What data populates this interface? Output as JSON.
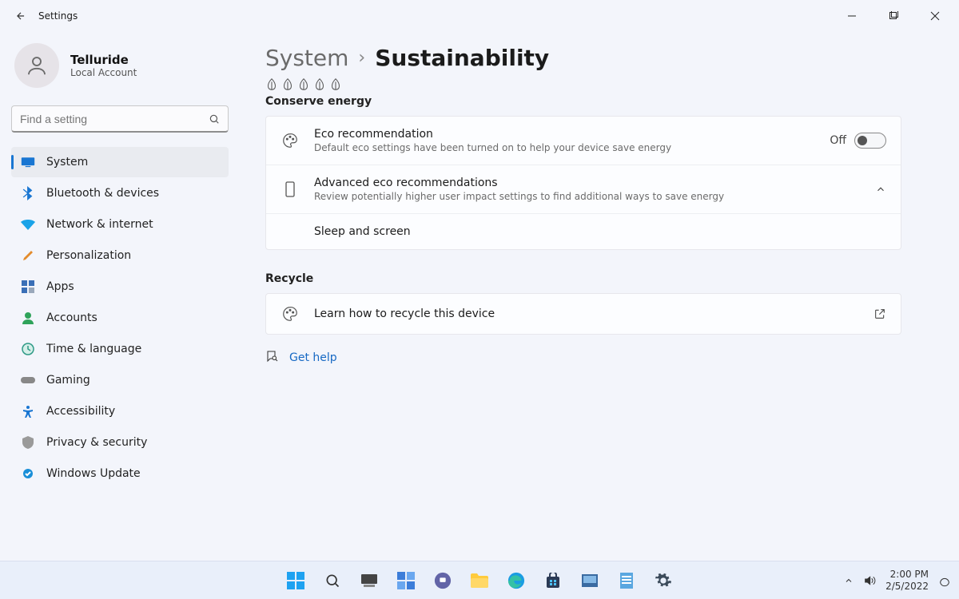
{
  "titlebar": {
    "app_title": "Settings"
  },
  "profile": {
    "name": "Telluride",
    "sub": "Local Account"
  },
  "search": {
    "placeholder": "Find a setting"
  },
  "sidebar": {
    "items": [
      {
        "label": "System"
      },
      {
        "label": "Bluetooth & devices"
      },
      {
        "label": "Network & internet"
      },
      {
        "label": "Personalization"
      },
      {
        "label": "Apps"
      },
      {
        "label": "Accounts"
      },
      {
        "label": "Time & language"
      },
      {
        "label": "Gaming"
      },
      {
        "label": "Accessibility"
      },
      {
        "label": "Privacy & security"
      },
      {
        "label": "Windows Update"
      }
    ]
  },
  "breadcrumb": {
    "root": "System",
    "leaf": "Sustainability"
  },
  "sections": {
    "conserve": {
      "title": "Conserve energy",
      "eco": {
        "title": "Eco recommendation",
        "desc": "Default eco settings have been turned on to help your device save energy",
        "toggle_label": "Off"
      },
      "advanced": {
        "title": "Advanced eco recommendations",
        "desc": "Review potentially higher user impact settings to find additional ways to save energy"
      },
      "sleep": {
        "title": "Sleep and screen"
      }
    },
    "recycle": {
      "title": "Recycle",
      "learn": "Learn how to recycle this device"
    }
  },
  "help": {
    "label": "Get help"
  },
  "tray": {
    "time": "2:00 PM",
    "date": "2/5/2022"
  }
}
